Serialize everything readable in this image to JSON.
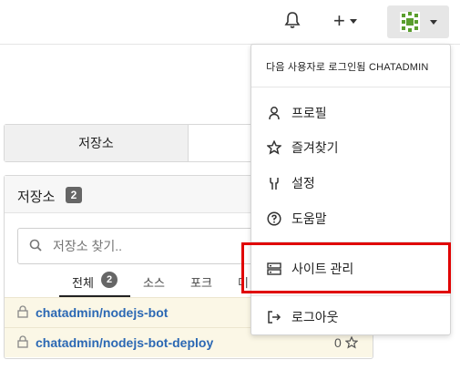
{
  "topbar": {
    "icons": [
      "bell-icon",
      "plus-icon",
      "avatar"
    ]
  },
  "repo_tabs": {
    "active": "저장소"
  },
  "panel": {
    "title": "저장소",
    "count": "2",
    "search": {
      "placeholder": "저장소 찾기.."
    },
    "filters": [
      {
        "label": "전체",
        "count": "2"
      },
      {
        "label": "소스"
      },
      {
        "label": "포크"
      },
      {
        "label": "미"
      }
    ],
    "repos": [
      {
        "name": "chatadmin/nodejs-bot",
        "stars": ""
      },
      {
        "name": "chatadmin/nodejs-bot-deploy",
        "stars": "0"
      }
    ]
  },
  "dropdown": {
    "header": "다음 사용자로 로그인됨 CHATADMIN",
    "items": [
      {
        "label": "프로필",
        "icon": "person-icon"
      },
      {
        "label": "즐겨찾기",
        "icon": "star-icon"
      },
      {
        "label": "설정",
        "icon": "tools-icon"
      },
      {
        "label": "도움말",
        "icon": "help-icon"
      },
      {
        "label": "사이트 관리",
        "icon": "server-icon"
      },
      {
        "label": "로그아웃",
        "icon": "sign-out-icon"
      }
    ]
  },
  "colors": {
    "highlight": "#e00000",
    "link": "#2b68b4",
    "row_bg": "#fbf7e6"
  }
}
